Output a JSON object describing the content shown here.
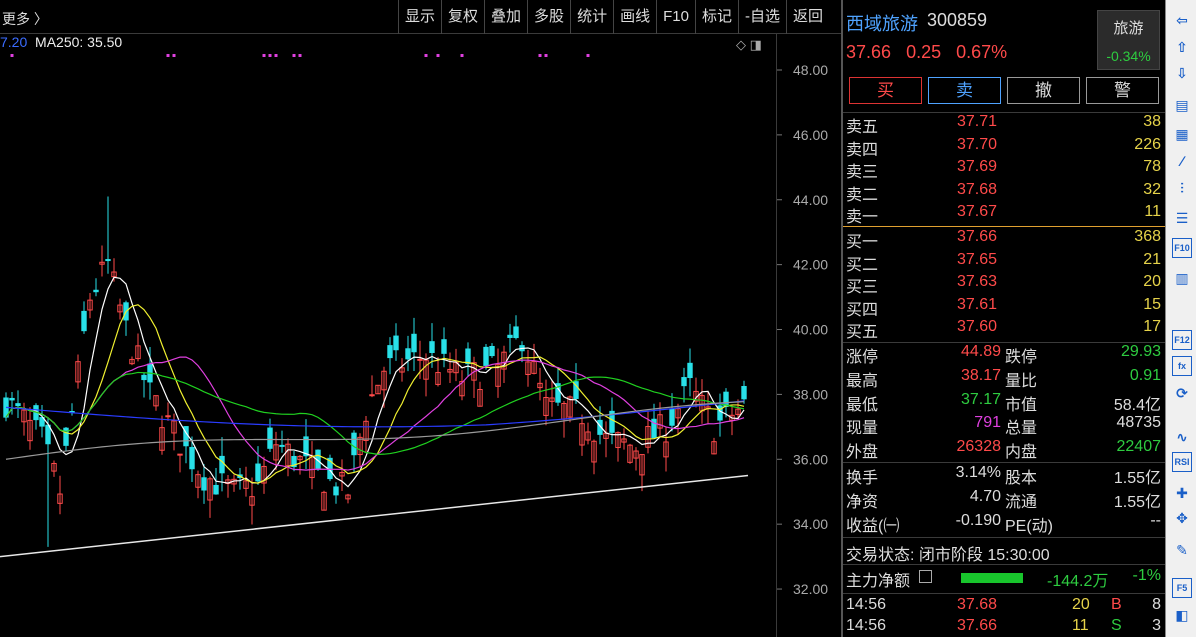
{
  "toolbar": {
    "more": "更多 〉",
    "buttons": [
      "显示",
      "复权",
      "叠加",
      "多股",
      "统计",
      "画线",
      "F10",
      "标记",
      "-自选",
      "返回"
    ]
  },
  "chart": {
    "ma_label_prefix": "7.20",
    "ma_label": "MA250: 35.50",
    "colors": {
      "up": "#ff4a4a",
      "down": "#29e0e8",
      "ma5": "#ffffff",
      "ma10": "#f0f030",
      "ma20": "#e040e0",
      "ma60": "#20d020",
      "ma120": "#2a3cff",
      "ma250": "#e8e8e8"
    }
  },
  "chart_data": {
    "type": "candlestick",
    "y_ticks": [
      "48.00",
      "46.00",
      "44.00",
      "42.00",
      "40.00",
      "38.00",
      "36.00",
      "34.00",
      "32.00"
    ],
    "ylim": [
      31.6,
      49.1
    ],
    "series": [
      {
        "name": "MA250",
        "values": [
          33.0,
          35.5
        ]
      }
    ]
  },
  "quote": {
    "name": "西域旅游",
    "code": "300859",
    "price": "37.66",
    "change": "0.25",
    "change_pct": "0.67%",
    "sector": "旅游",
    "sector_change": "-0.34%"
  },
  "trade_buttons": [
    "买",
    "卖",
    "撤",
    "警"
  ],
  "order_book": {
    "asks": [
      {
        "label": "卖五",
        "price": "37.71",
        "vol": "38"
      },
      {
        "label": "卖四",
        "price": "37.70",
        "vol": "226"
      },
      {
        "label": "卖三",
        "price": "37.69",
        "vol": "78"
      },
      {
        "label": "卖二",
        "price": "37.68",
        "vol": "32"
      },
      {
        "label": "卖一",
        "price": "37.67",
        "vol": "11"
      }
    ],
    "bids": [
      {
        "label": "买一",
        "price": "37.66",
        "vol": "368"
      },
      {
        "label": "买二",
        "price": "37.65",
        "vol": "21"
      },
      {
        "label": "买三",
        "price": "37.63",
        "vol": "20"
      },
      {
        "label": "买四",
        "price": "37.61",
        "vol": "15"
      },
      {
        "label": "买五",
        "price": "37.60",
        "vol": "17"
      }
    ]
  },
  "stats": [
    {
      "l1": "涨停",
      "v1": "44.89",
      "c1": "red",
      "l2": "跌停",
      "v2": "29.93",
      "c2": "green"
    },
    {
      "l1": "最高",
      "v1": "38.17",
      "c1": "red",
      "l2": "量比",
      "v2": "0.91",
      "c2": "green"
    },
    {
      "l1": "最低",
      "v1": "37.17",
      "c1": "green",
      "l2": "市值",
      "v2": "58.4亿",
      "c2": "white"
    },
    {
      "l1": "现量",
      "v1": "791",
      "c1": "magenta",
      "l2": "总量",
      "v2": "48735",
      "c2": "white"
    },
    {
      "l1": "外盘",
      "v1": "26328",
      "c1": "red",
      "l2": "内盘",
      "v2": "22407",
      "c2": "green"
    }
  ],
  "stats2": [
    {
      "l1": "换手",
      "v1": "3.14%",
      "c1": "white",
      "l2": "股本",
      "v2": "1.55亿",
      "c2": "white"
    },
    {
      "l1": "净资",
      "v1": "4.70",
      "c1": "white",
      "l2": "流通",
      "v2": "1.55亿",
      "c2": "white"
    },
    {
      "l1": "收益(㈠",
      "v1": "-0.190",
      "c1": "white",
      "l2": "PE(动)",
      "v2": "--",
      "c2": "white"
    }
  ],
  "trade_status": "交易状态: 闭市阶段 15:30:00",
  "money_flow": {
    "label": "主力净额",
    "value": "-144.2万",
    "pct": "-1%"
  },
  "ticks": [
    {
      "time": "14:56",
      "price": "37.68",
      "vol": "20",
      "side": "B",
      "n": "8"
    },
    {
      "time": "14:56",
      "price": "37.66",
      "vol": "11",
      "side": "S",
      "n": "3"
    }
  ],
  "sidebar_icons": [
    "back-arrow-icon",
    "up-arrow-icon",
    "down-arrow-icon",
    "report-icon",
    "grid-icon",
    "line-chart-icon",
    "kline-icon",
    "list-icon",
    "f10-icon",
    "layout-icon",
    "f12-icon",
    "fx-icon",
    "refresh-icon",
    "wave-icon",
    "rsi-icon",
    "cross-icon",
    "move-icon",
    "pen-icon",
    "f5-icon",
    "window-icon"
  ]
}
